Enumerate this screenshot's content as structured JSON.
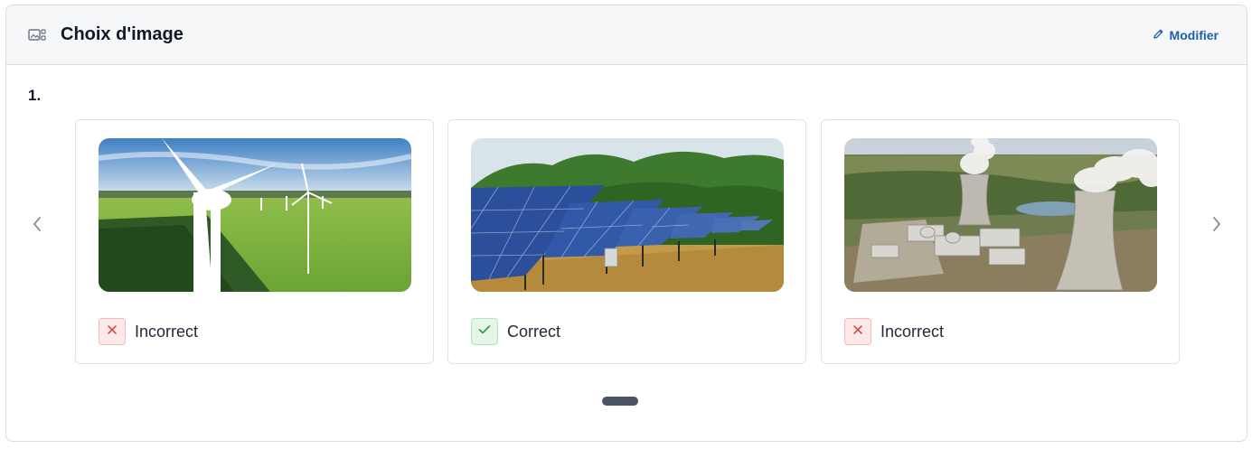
{
  "header": {
    "title": "Choix d'image",
    "edit_label": "Modifier",
    "icon": "image-choice-icon"
  },
  "question": {
    "number": "1."
  },
  "cards": [
    {
      "image": "wind-turbines-photo",
      "status": "incorrect",
      "status_label": "Incorrect",
      "status_icon": "cross-icon"
    },
    {
      "image": "solar-panels-photo",
      "status": "correct",
      "status_label": "Correct",
      "status_icon": "check-icon"
    },
    {
      "image": "nuclear-plant-photo",
      "status": "incorrect",
      "status_label": "Incorrect",
      "status_icon": "cross-icon"
    }
  ],
  "pagination": {
    "current_page": 1,
    "total_pages": 1
  },
  "colors": {
    "accent": "#1d5fa8",
    "incorrect": "#d63b3b",
    "correct": "#2e9e4a",
    "pager": "#4b5563"
  }
}
